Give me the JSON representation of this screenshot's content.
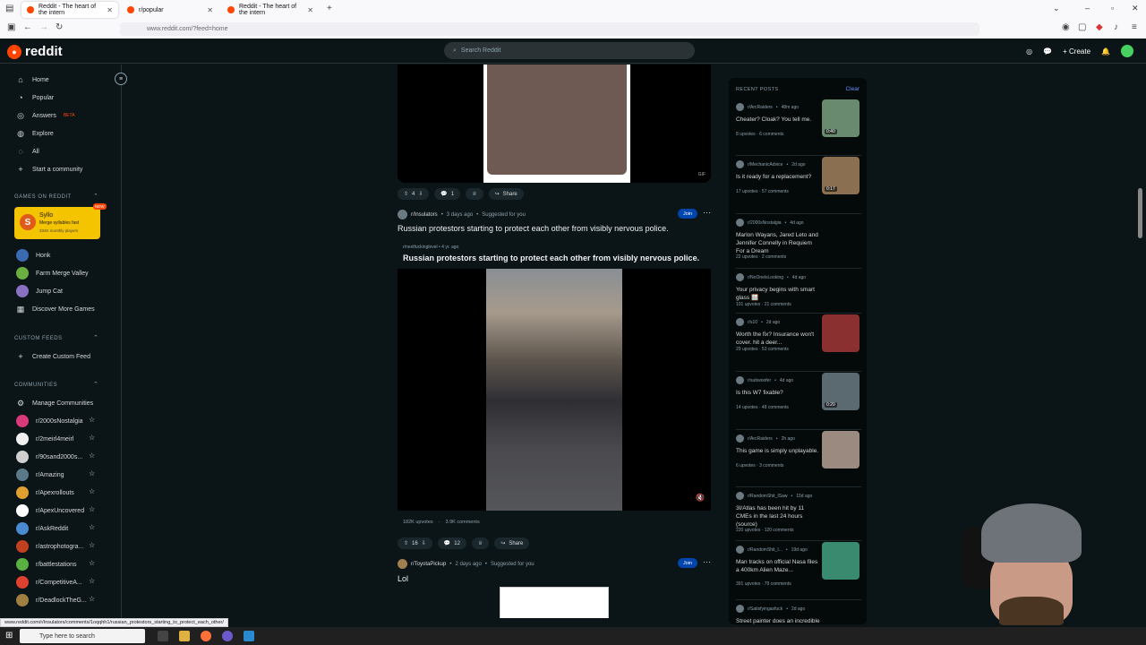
{
  "browser": {
    "tabs": [
      {
        "label": "Reddit - The heart of the intern"
      },
      {
        "label": "r/popular"
      },
      {
        "label": "Reddit - The heart of the intern"
      }
    ],
    "url": "www.reddit.com/?feed=home"
  },
  "header": {
    "logo_text": "reddit",
    "search_placeholder": "Search Reddit",
    "create_label": "Create"
  },
  "sidebar": {
    "nav": [
      {
        "label": "Home",
        "icon": "home-icon"
      },
      {
        "label": "Popular",
        "icon": "popular-icon"
      },
      {
        "label": "Answers",
        "icon": "answers-icon",
        "badge": "BETA"
      },
      {
        "label": "Explore",
        "icon": "explore-icon"
      },
      {
        "label": "All",
        "icon": "all-icon"
      },
      {
        "label": "Start a community",
        "icon": "plus-icon"
      }
    ],
    "games_heading": "GAMES ON REDDIT",
    "syllo": {
      "title": "Syllo",
      "subtitle": "Merge syllables fast",
      "players": "334K monthly players",
      "badge": "NEW"
    },
    "games": [
      {
        "label": "Honk"
      },
      {
        "label": "Farm Merge Valley"
      },
      {
        "label": "Jump Cat"
      },
      {
        "label": "Discover More Games"
      }
    ],
    "custom_feeds_heading": "CUSTOM FEEDS",
    "create_custom_feed": "Create Custom Feed",
    "communities_heading": "COMMUNITIES",
    "manage_communities": "Manage Communities",
    "communities": [
      {
        "name": "r/2000sNostalgia",
        "color": "#d93a7a"
      },
      {
        "name": "r/2meirl4meirl",
        "color": "#f0f0f0"
      },
      {
        "name": "r/90sand2000s...",
        "color": "#d0d0d0"
      },
      {
        "name": "r/Amazing",
        "color": "#5a7a8a"
      },
      {
        "name": "r/Apexrollouts",
        "color": "#e0a030"
      },
      {
        "name": "r/ApexUncovered",
        "color": "#ffffff"
      },
      {
        "name": "r/AskReddit",
        "color": "#4a8ad0"
      },
      {
        "name": "r/astrophotogra...",
        "color": "#c04020"
      },
      {
        "name": "r/battlestations",
        "color": "#5ab040"
      },
      {
        "name": "r/CompetitiveA...",
        "color": "#e04030"
      },
      {
        "name": "r/DeadlockTheG...",
        "color": "#a08040"
      }
    ]
  },
  "feed": {
    "post1": {
      "gif_label": "GIF",
      "votes": "4",
      "comments": "1",
      "share": "Share"
    },
    "post2": {
      "subreddit": "r/Insulators",
      "time": "3 days ago",
      "suggested": "Suggested for you",
      "join": "Join",
      "title": "Russian protestors starting to protect each other from visibly nervous police.",
      "xpost_subreddit": "r/nextfuckinglevel",
      "xpost_time": "4 yr. ago",
      "xpost_title": "Russian protestors starting to protect each other from visibly nervous police.",
      "upvotes": "182K upvotes",
      "comments_total": "3.9K comments",
      "votes": "16",
      "comments": "12",
      "share": "Share"
    },
    "post3": {
      "subreddit": "r/ToyotaPickup",
      "time": "2 days ago",
      "suggested": "Suggested for you",
      "join": "Join",
      "title": "Lol"
    }
  },
  "recent": {
    "heading": "RECENT POSTS",
    "clear": "Clear",
    "posts": [
      {
        "sub": "r/ArcRaiders",
        "time": "48m ago",
        "title": "Cheater? Cloak? You tell me.",
        "upvotes": "8 upvotes",
        "comments": "6 comments",
        "thumb": "0:40",
        "color": "#6a8a70"
      },
      {
        "sub": "r/MechanicAdvice",
        "time": "2d ago",
        "title": "Is it ready for a replacement?",
        "upvotes": "17 upvotes",
        "comments": "57 comments",
        "thumb": "0:17",
        "color": "#8a7050"
      },
      {
        "sub": "r/2000sNostalgia",
        "time": "4d ago",
        "title": "Marlon Wayans, Jared Leto and Jennifer Connelly in Requiem For a Dream",
        "upvotes": "22 upvotes",
        "comments": "2 comments",
        "thumb": "",
        "color": ""
      },
      {
        "sub": "r/NoOnelsLooking",
        "time": "4d ago",
        "title": "Your privacy begins with smart glass 🪟",
        "upvotes": "101 upvotes",
        "comments": "21 comments",
        "thumb": "",
        "color": ""
      },
      {
        "sub": "r/s10",
        "time": "2d ago",
        "title": "Worth the fix? Insurance won't cover. hit a deer...",
        "upvotes": "29 upvotes",
        "comments": "53 comments",
        "thumb": "",
        "color": "#8a3030"
      },
      {
        "sub": "r/subwoofer",
        "time": "4d ago",
        "title": "Is this W7 fixable?",
        "upvotes": "14 upvotes",
        "comments": "48 comments",
        "thumb": "0:20",
        "color": "#5a6a70"
      },
      {
        "sub": "r/ArcRaiders",
        "time": "2h ago",
        "title": "This game is simply unplayable.",
        "upvotes": "6 upvotes",
        "comments": "3 comments",
        "thumb": "",
        "color": "#9a8a80"
      },
      {
        "sub": "r/RandomShit_ISaw",
        "time": "15d ago",
        "title": "3I/Atlas has been hit by 11 CMEs in the last 24 hours (source)",
        "upvotes": "220 upvotes",
        "comments": "120 comments",
        "thumb": "",
        "color": ""
      },
      {
        "sub": "r/RandomShit_I...",
        "time": "19d ago",
        "title": "Man tracks on official Nasa files a 400km Alien Maze...",
        "upvotes": "391 upvotes",
        "comments": "79 comments",
        "thumb": "",
        "color": "#3a8a70"
      },
      {
        "sub": "r/Satisfyingasfuck",
        "time": "2d ago",
        "title": "Street painter does an incredible spray",
        "upvotes": "",
        "comments": "",
        "thumb": "",
        "color": ""
      }
    ]
  },
  "status_url": "www.reddit.com/r/Insulators/comments/1oqqhh1/russian_protestors_starting_to_protect_each_other/",
  "taskbar": {
    "search_placeholder": "Type here to search"
  }
}
